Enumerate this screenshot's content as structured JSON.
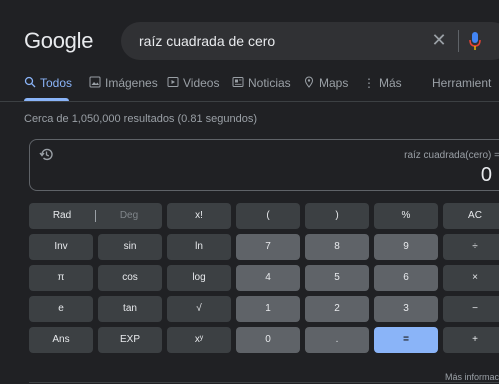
{
  "header": {
    "logo": "Google",
    "query": "raíz cuadrada de cero"
  },
  "tabs": [
    {
      "label": "Todos",
      "active": true
    },
    {
      "label": "Imágenes"
    },
    {
      "label": "Videos"
    },
    {
      "label": "Noticias"
    },
    {
      "label": "Maps"
    },
    {
      "label": "Más"
    },
    {
      "label": "Herramient"
    }
  ],
  "stats": "Cerca de 1,050,000 resultados (0.81 segundos)",
  "calculator": {
    "expression": "raíz cuadrada(cero) =",
    "result": "0",
    "rad_label": "Rad",
    "deg_label": "Deg",
    "keys": {
      "fact": "x!",
      "lparen": "(",
      "rparen": ")",
      "percent": "%",
      "ac": "AC",
      "inv": "Inv",
      "sin": "sin",
      "ln": "ln",
      "seven": "7",
      "eight": "8",
      "nine": "9",
      "divide": "÷",
      "pi": "π",
      "cos": "cos",
      "log": "log",
      "four": "4",
      "five": "5",
      "six": "6",
      "multiply": "×",
      "e": "e",
      "tan": "tan",
      "sqrt": "√",
      "one": "1",
      "two": "2",
      "three": "3",
      "minus": "−",
      "ans": "Ans",
      "exp": "EXP",
      "power": "xʸ",
      "zero": "0",
      "dot": ".",
      "equals": "=",
      "plus": "+"
    }
  },
  "more_info": "Más informac",
  "colors": {
    "accent": "#8ab4f8",
    "background": "#202124",
    "key": "#3c4043",
    "number_key": "#5f6368"
  }
}
